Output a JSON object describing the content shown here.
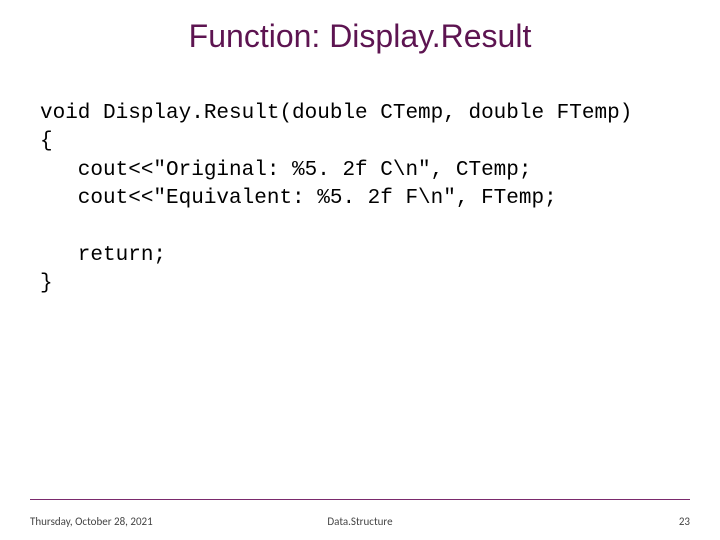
{
  "title": "Function: Display.Result",
  "code": {
    "l1": "void Display.Result(double CTemp, double FTemp)",
    "l2": "{",
    "l3": "   cout<<\"Original: %5. 2f C\\n\", CTemp;",
    "l4": "   cout<<\"Equivalent: %5. 2f F\\n\", FTemp;",
    "l5": "",
    "l6": "   return;",
    "l7": "}"
  },
  "footer": {
    "date": "Thursday, October 28, 2021",
    "mid": "Data.Structure",
    "page": "23"
  }
}
